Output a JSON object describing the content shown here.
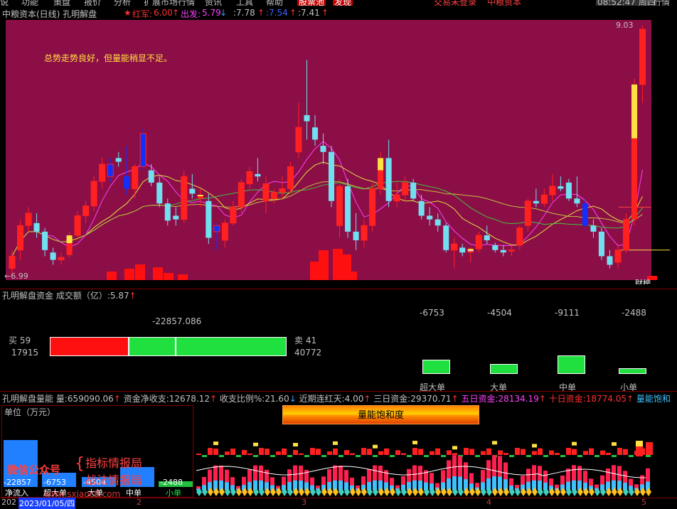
{
  "menubar": {
    "items": [
      "说",
      "功能",
      "策盘",
      "报价",
      "分析",
      "扩展市场行情",
      "资讯",
      "工具",
      "帮助",
      "股票池",
      "发现",
      "交易未登录",
      "中粮资本"
    ],
    "clock": "08:52:47 周四",
    "right_item": "行情"
  },
  "header": {
    "title": "中粮资本(日线) 孔明解盘",
    "hongjun_label": "红军:",
    "hongjun_value": "6.00",
    "chufa_label": "出发:",
    "chufa_value": "5.79",
    "v1": ":7.78",
    "v2": ":7.54",
    "v3": ":7.41"
  },
  "main_chart": {
    "comment": "总势走势良好，但量能稍显不足。",
    "high_label": "9.03",
    "low_label": "6.99",
    "tag": "财榜",
    "colors": {
      "bg": "#8c0e47",
      "up": "#ff2020",
      "down": "#70e0f0",
      "blue": "#1030ff",
      "yellow": "#ffe040"
    }
  },
  "chart_data": {
    "type": "candlestick",
    "title": "中粮资本(日线) 孔明解盘",
    "ylim": [
      6.99,
      9.03
    ],
    "ohlc": [
      [
        7.05,
        7.2,
        6.99,
        7.15
      ],
      [
        7.2,
        7.45,
        7.12,
        7.4
      ],
      [
        7.4,
        7.55,
        7.35,
        7.5
      ],
      [
        7.42,
        7.5,
        7.3,
        7.35
      ],
      [
        7.35,
        7.38,
        7.15,
        7.2
      ],
      [
        7.18,
        7.22,
        7.08,
        7.12
      ],
      [
        7.12,
        7.18,
        7.08,
        7.14
      ],
      [
        7.16,
        7.35,
        7.14,
        7.32
      ],
      [
        7.32,
        7.52,
        7.28,
        7.48
      ],
      [
        7.48,
        7.6,
        7.42,
        7.56
      ],
      [
        7.56,
        7.8,
        7.52,
        7.76
      ],
      [
        7.76,
        7.95,
        7.7,
        7.9
      ],
      [
        7.8,
        7.95,
        7.75,
        7.9
      ],
      [
        7.95,
        8.0,
        7.88,
        7.92
      ],
      [
        7.8,
        8.05,
        7.65,
        7.7
      ],
      [
        7.7,
        7.9,
        7.62,
        7.88
      ],
      [
        7.88,
        8.2,
        7.85,
        8.15
      ],
      [
        7.85,
        7.9,
        7.72,
        7.75
      ],
      [
        7.75,
        7.8,
        7.55,
        7.58
      ],
      [
        7.58,
        7.62,
        7.4,
        7.44
      ],
      [
        7.48,
        7.55,
        7.4,
        7.45
      ],
      [
        7.45,
        7.85,
        7.42,
        7.8
      ],
      [
        7.7,
        7.82,
        7.62,
        7.66
      ],
      [
        7.62,
        7.7,
        7.55,
        7.65
      ],
      [
        7.6,
        7.66,
        7.25,
        7.3
      ],
      [
        7.35,
        7.42,
        7.2,
        7.4
      ],
      [
        7.28,
        7.45,
        7.22,
        7.42
      ],
      [
        7.42,
        7.6,
        7.4,
        7.55
      ],
      [
        7.55,
        7.78,
        7.5,
        7.75
      ],
      [
        7.74,
        7.88,
        7.7,
        7.84
      ],
      [
        7.82,
        7.95,
        7.76,
        7.8
      ],
      [
        7.6,
        7.8,
        7.5,
        7.74
      ],
      [
        7.62,
        7.7,
        7.58,
        7.67
      ],
      [
        7.67,
        7.8,
        7.62,
        7.7
      ],
      [
        7.7,
        7.92,
        7.66,
        7.88
      ],
      [
        8.0,
        8.4,
        7.95,
        8.2
      ],
      [
        8.3,
        8.75,
        8.1,
        8.25
      ],
      [
        8.2,
        8.3,
        8.05,
        8.1
      ],
      [
        8.05,
        8.15,
        7.9,
        8.0
      ],
      [
        8.0,
        8.05,
        7.55,
        7.6
      ],
      [
        7.4,
        7.78,
        7.3,
        7.72
      ],
      [
        7.72,
        7.78,
        7.3,
        7.35
      ],
      [
        7.35,
        7.5,
        7.2,
        7.28
      ],
      [
        7.28,
        7.45,
        7.22,
        7.4
      ],
      [
        7.4,
        7.75,
        7.35,
        7.7
      ],
      [
        7.7,
        8.0,
        7.65,
        7.95
      ],
      [
        7.95,
        8.1,
        7.55,
        7.6
      ],
      [
        7.6,
        7.75,
        7.55,
        7.65
      ],
      [
        7.65,
        7.8,
        7.6,
        7.75
      ],
      [
        7.75,
        7.78,
        7.6,
        7.62
      ],
      [
        7.6,
        7.65,
        7.45,
        7.48
      ],
      [
        7.48,
        7.55,
        7.4,
        7.45
      ],
      [
        7.45,
        7.5,
        7.35,
        7.4
      ],
      [
        7.4,
        7.42,
        7.18,
        7.2
      ],
      [
        7.2,
        7.3,
        7.05,
        7.25
      ],
      [
        7.22,
        7.25,
        7.15,
        7.18
      ],
      [
        7.18,
        7.22,
        7.1,
        7.21
      ],
      [
        7.21,
        7.35,
        7.18,
        7.32
      ],
      [
        7.32,
        7.4,
        7.25,
        7.28
      ],
      [
        7.24,
        7.26,
        7.18,
        7.2
      ],
      [
        7.2,
        7.24,
        7.15,
        7.18
      ],
      [
        7.2,
        7.24,
        7.15,
        7.2
      ],
      [
        7.24,
        7.4,
        7.2,
        7.38
      ],
      [
        7.4,
        7.62,
        7.35,
        7.6
      ],
      [
        7.6,
        7.7,
        7.55,
        7.58
      ],
      [
        7.58,
        7.7,
        7.55,
        7.65
      ],
      [
        7.65,
        7.82,
        7.6,
        7.72
      ],
      [
        7.72,
        7.8,
        7.68,
        7.7
      ],
      [
        7.75,
        7.78,
        7.6,
        7.62
      ],
      [
        7.62,
        7.8,
        7.55,
        7.58
      ],
      [
        7.58,
        7.62,
        7.38,
        7.4
      ],
      [
        7.4,
        7.45,
        7.3,
        7.35
      ],
      [
        7.35,
        7.38,
        7.12,
        7.15
      ],
      [
        7.15,
        7.2,
        7.05,
        7.08
      ],
      [
        7.1,
        7.25,
        7.05,
        7.2
      ],
      [
        7.2,
        7.5,
        7.18,
        7.45
      ],
      [
        7.45,
        8.6,
        7.4,
        8.55
      ],
      [
        8.55,
        9.03,
        8.4,
        9.0
      ]
    ],
    "tags": [
      null,
      null,
      null,
      null,
      null,
      null,
      null,
      "mix",
      null,
      null,
      null,
      null,
      "blue",
      null,
      "blue",
      null,
      "blue",
      null,
      null,
      null,
      null,
      null,
      null,
      "mix",
      null,
      "blue",
      null,
      null,
      null,
      null,
      null,
      null,
      null,
      null,
      null,
      null,
      null,
      null,
      null,
      null,
      null,
      null,
      null,
      null,
      null,
      "mix",
      null,
      null,
      null,
      null,
      null,
      null,
      null,
      null,
      null,
      null,
      "yellow",
      null,
      null,
      null,
      null,
      null,
      null,
      null,
      null,
      null,
      null,
      null,
      null,
      null,
      "blue",
      null,
      null,
      null,
      null,
      null,
      "mix",
      null
    ]
  },
  "fund_panel": {
    "title": "孔明解盘资金",
    "turnover_label": "成交额（亿）",
    "turnover_value": ":5.87",
    "total_value": "-22857.086",
    "buy_label": "买 59",
    "buy_value": "17915",
    "sell_label": "卖 41",
    "sell_value": "40772",
    "bars": [
      {
        "label": "超大单",
        "value": "-6753"
      },
      {
        "label": "大单",
        "value": "-4504"
      },
      {
        "label": "中单",
        "value": "-9111"
      },
      {
        "label": "小单",
        "value": "-2488"
      }
    ]
  },
  "energy_panel": {
    "title": "孔明解盘量能",
    "stats": [
      {
        "label": "量:",
        "value": "659090.06"
      },
      {
        "label": "资金净收支:",
        "value": "12678.12"
      },
      {
        "label": "收支比例%:",
        "value": "21.60"
      },
      {
        "label": "近期连红天:",
        "value": "4.00"
      },
      {
        "label": "三日资金:",
        "value": "29370.71"
      },
      {
        "label": "五日资金:",
        "value": "28134.19"
      },
      {
        "label": "十日资金:",
        "value": "18774.05"
      },
      {
        "label": "量能饱和",
        "value": ""
      }
    ],
    "saturation_label": "量能饱和度",
    "unit_label": "单位（万元）",
    "watermark_1": "微信公众号",
    "watermark_2": "指标情报局",
    "watermark_3": "战法情报局",
    "watermark_4": "www.sxiaoc8.com",
    "mini_bars": [
      {
        "label": "净流入",
        "value": "-22857"
      },
      {
        "label": "超大单",
        "value": "-6753"
      },
      {
        "label": "大单",
        "value": "-4504"
      },
      {
        "label": "中单",
        "value": "-9111"
      },
      {
        "label": "小单",
        "value": "-2488"
      }
    ]
  },
  "timeline": {
    "labels": [
      "2023/01/05/四",
      "2",
      "3",
      "4",
      "5"
    ],
    "prefix": "202"
  }
}
